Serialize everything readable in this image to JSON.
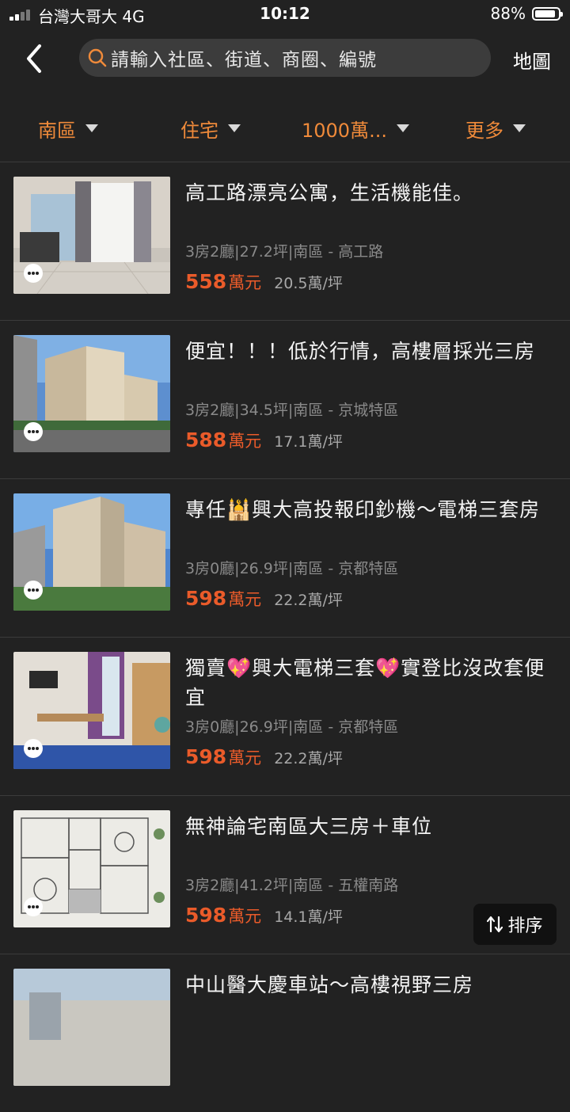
{
  "status_bar": {
    "carrier": "台灣大哥大  4G",
    "time": "10:12",
    "battery": "88%",
    "battery_level": 0.88
  },
  "header": {
    "search_placeholder": "請輸入社區、街道、商圈、編號",
    "map_label": "地圖"
  },
  "filters": [
    {
      "label": "南區"
    },
    {
      "label": "住宅"
    },
    {
      "label": "1000萬..."
    },
    {
      "label": "更多"
    }
  ],
  "listings": [
    {
      "title": "高工路漂亮公寓，生活機能佳。",
      "meta": "3房2廳|27.2坪|南區 - 高工路",
      "price": "558",
      "unit": "萬元",
      "per_ping": "20.5萬/坪"
    },
    {
      "title": "便宜！！！低於行情，高樓層採光三房",
      "meta": "3房2廳|34.5坪|南區 - 京城特區",
      "price": "588",
      "unit": "萬元",
      "per_ping": "17.1萬/坪"
    },
    {
      "title": "專任🕌興大高投報印鈔機～電梯三套房",
      "meta": "3房0廳|26.9坪|南區 - 京都特區",
      "price": "598",
      "unit": "萬元",
      "per_ping": "22.2萬/坪"
    },
    {
      "title": "獨賣💖興大電梯三套💖實登比沒改套便宜",
      "meta": "3房0廳|26.9坪|南區 - 京都特區",
      "price": "598",
      "unit": "萬元",
      "per_ping": "22.2萬/坪"
    },
    {
      "title": "無神論宅南區大三房＋車位",
      "meta": "3房2廳|41.2坪|南區 - 五權南路",
      "price": "598",
      "unit": "萬元",
      "per_ping": "14.1萬/坪"
    },
    {
      "title": "中山醫大慶車站～高樓視野三房"
    }
  ],
  "sort": {
    "label": "排序"
  }
}
